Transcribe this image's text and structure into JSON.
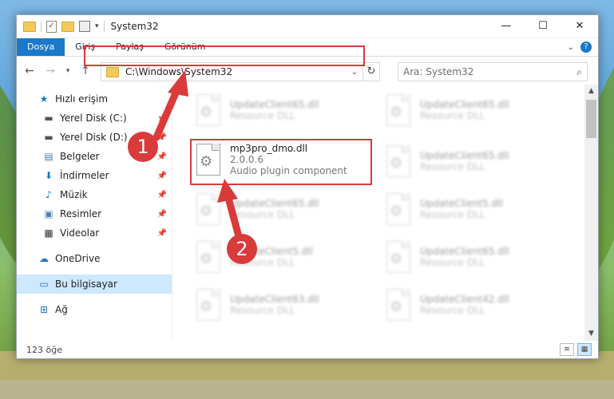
{
  "titlebar": {
    "title": "System32"
  },
  "window_controls": {
    "minimize": "—",
    "maximize": "☐",
    "close": "✕"
  },
  "ribbon": {
    "tabs": [
      "Dosya",
      "Giriş",
      "Paylaş",
      "Görünüm"
    ]
  },
  "address": {
    "path": "C:\\Windows\\System32",
    "search_placeholder": "Ara: System32"
  },
  "nav": {
    "items": [
      {
        "label": "Hızlı erişim",
        "icon": "star-icon"
      },
      {
        "label": "Yerel Disk (C:)",
        "icon": "drive-icon",
        "pinned": true
      },
      {
        "label": "Yerel Disk (D:)",
        "icon": "drive-icon",
        "pinned": true
      },
      {
        "label": "Belgeler",
        "icon": "documents-icon",
        "pinned": true
      },
      {
        "label": "İndirmeler",
        "icon": "downloads-icon",
        "pinned": true
      },
      {
        "label": "Müzik",
        "icon": "music-icon",
        "pinned": true
      },
      {
        "label": "Resimler",
        "icon": "pictures-icon",
        "pinned": true
      },
      {
        "label": "Videolar",
        "icon": "videos-icon",
        "pinned": true
      },
      {
        "label": "OneDrive",
        "icon": "cloud-icon"
      },
      {
        "label": "Bu bilgisayar",
        "icon": "computer-icon",
        "selected": true
      },
      {
        "label": "Ağ",
        "icon": "network-icon"
      }
    ]
  },
  "files": [
    {
      "name": "UpdateClient65.dll",
      "line2": "Resource DLL"
    },
    {
      "name": "UpdateClient65.dll",
      "line2": "Resource DLL"
    },
    {
      "name": "mp3pro_dmo.dll",
      "line2": "2.0.0.6",
      "line3": "Audio plugin component"
    },
    {
      "name": "UpdateClient65.dll",
      "line2": "Resource DLL"
    },
    {
      "name": "UpdateClient65.dll",
      "line2": "Resource DLL"
    },
    {
      "name": "UpdateClient5.dll",
      "line2": "Resource DLL"
    },
    {
      "name": "UpdateClient5.dll",
      "line2": "Resource DLL"
    },
    {
      "name": "UpdateClient65.dll",
      "line2": "Resource DLL"
    },
    {
      "name": "UpdateClient63.dll",
      "line2": "Resource DLL"
    },
    {
      "name": "UpdateClient42.dll",
      "line2": "Resource DLL"
    }
  ],
  "status": {
    "count": "123 öğe"
  },
  "annotations": {
    "badge1": "1",
    "badge2": "2",
    "color": "#d93a3a"
  }
}
